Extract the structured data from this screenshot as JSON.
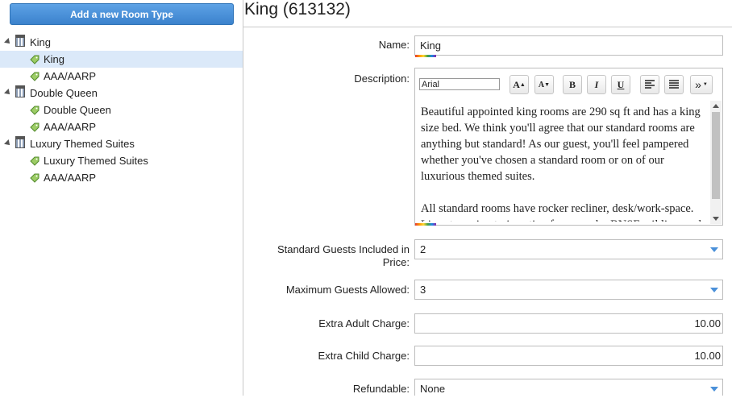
{
  "sidebar": {
    "add_button_label": "Add a new Room Type",
    "tree": [
      {
        "label": "King",
        "children": [
          "King",
          "AAA/AARP"
        ]
      },
      {
        "label": "Double Queen",
        "children": [
          "Double Queen",
          "AAA/AARP"
        ]
      },
      {
        "label": "Luxury Themed Suites",
        "children": [
          "Luxury Themed Suites",
          "AAA/AARP"
        ]
      }
    ],
    "selected": "King"
  },
  "main": {
    "title": "King (613132)",
    "form": {
      "name_label": "Name:",
      "name_value": "King",
      "description_label": "Description:",
      "editor": {
        "font_value": "Arial",
        "buttons": {
          "grow": "A",
          "shrink": "A",
          "bold": "B",
          "italic": "I",
          "underline": "U",
          "more": "»"
        },
        "paragraphs": [
          "Beautiful appointed king rooms are 290 sq ft and has a king size bed. We think you'll agree that our standard rooms are anything but standard! As our guest, you'll feel pampered whether you've chosen a standard room or on of our luxurious themed suites.",
          "All standard rooms have rocker recliner, desk/work-space. Live streaming train action from nearby BNSF rail line, and a mini fridge and microwave. TV with cable."
        ]
      },
      "std_guests_label_1": "Standard Guests Included in",
      "std_guests_label_2": "Price:",
      "std_guests_value": "2",
      "max_guests_label": "Maximum Guests Allowed:",
      "max_guests_value": "3",
      "extra_adult_label": "Extra Adult Charge:",
      "extra_adult_value": "10.00",
      "extra_child_label": "Extra Child Charge:",
      "extra_child_value": "10.00",
      "refundable_label": "Refundable:",
      "refundable_value": "None"
    }
  },
  "colors": {
    "accent": "#3b82cc",
    "selected_row": "#dbe9f9",
    "dropdown_arrow": "#4a90d9"
  },
  "icons": {
    "tree_toggle": "triangle-expanded-icon",
    "parent": "building-icon",
    "child": "price-tag-icon"
  }
}
